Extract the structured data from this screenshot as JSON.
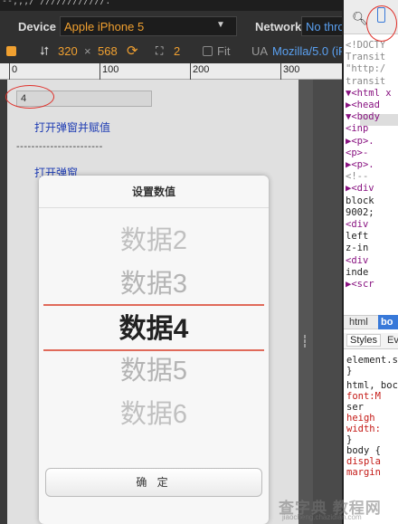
{
  "url_fragment": "--,,,/ ////////////.",
  "toolbar": {
    "device_label": "Device",
    "device_value": "Apple iPhone 5",
    "network_label": "Network",
    "network_value": "No thro",
    "width": "320",
    "times": "×",
    "height": "568",
    "scale": "2",
    "fit_label": "Fit",
    "ua_label": "UA",
    "ua_value": "Mozilla/5.0 (iPh"
  },
  "ruler": {
    "marks": [
      "0",
      "100",
      "200",
      "300"
    ]
  },
  "page": {
    "input_value": "4",
    "link1": "打开弹窗并赋值",
    "dashes": "-----------------------",
    "link2": "打开弹窗"
  },
  "dialog": {
    "title": "设置数值",
    "items": [
      "数据2",
      "数据3",
      "数据4",
      "数据5",
      "数据6"
    ],
    "selected": "数据4",
    "confirm": "确 定"
  },
  "devtools": {
    "lines": [
      {
        "text": "<!DOCTY",
        "cls": "gc"
      },
      {
        "text": "Transit",
        "cls": "gc"
      },
      {
        "text": "\"http:/",
        "cls": "gc"
      },
      {
        "text": "transit",
        "cls": "gc"
      },
      {
        "text": "▼<html x",
        "cls": "tagc"
      },
      {
        "text": " ▶<head",
        "cls": "tagc"
      },
      {
        "text": " ▼<body",
        "cls": "tagc"
      },
      {
        "text": "   <inp",
        "cls": "tagc"
      },
      {
        "text": "  ▶<p>.",
        "cls": "tagc"
      },
      {
        "text": "   <p>-",
        "cls": "tagc"
      },
      {
        "text": "  ▶<p>.",
        "cls": "tagc"
      },
      {
        "text": "   <!--",
        "cls": "gc"
      },
      {
        "text": "  ▶<div",
        "cls": "tagc"
      },
      {
        "text": " block",
        "cls": "bc"
      },
      {
        "text": " 9002;",
        "cls": "bc"
      },
      {
        "text": "   <div",
        "cls": "tagc"
      },
      {
        "text": "   left",
        "cls": "bc"
      },
      {
        "text": "   z-in",
        "cls": "bc"
      },
      {
        "text": "   <div",
        "cls": "tagc"
      },
      {
        "text": "   inde",
        "cls": "bc"
      },
      {
        "text": "  ▶<scr",
        "cls": "tagc"
      }
    ],
    "tab_html": "html",
    "tab_body": "bo",
    "styles_tab": "Styles",
    "styles_tab2": "Ev",
    "rules": [
      {
        "text": "element.s",
        "cls": "bc"
      },
      {
        "text": "}",
        "cls": "bc"
      },
      {
        "text": "html, boc",
        "cls": "bc"
      },
      {
        "text": "  font:M",
        "cls": "rc"
      },
      {
        "text": "    ser",
        "cls": "bc"
      },
      {
        "text": "  heigh",
        "cls": "rc"
      },
      {
        "text": "  width:",
        "cls": "rc"
      },
      {
        "text": "}",
        "cls": "bc"
      },
      {
        "text": "body {",
        "cls": "bc"
      },
      {
        "text": "  displa",
        "cls": "rc"
      },
      {
        "text": "  margin",
        "cls": "rc"
      }
    ]
  },
  "watermark": {
    "text": "查字典 教程网",
    "sub": "jiaocheng.chazidian.com"
  },
  "colors": {
    "accent": "#f0a030",
    "annotation": "#e0302a",
    "picker_line": "#e06a5a"
  }
}
